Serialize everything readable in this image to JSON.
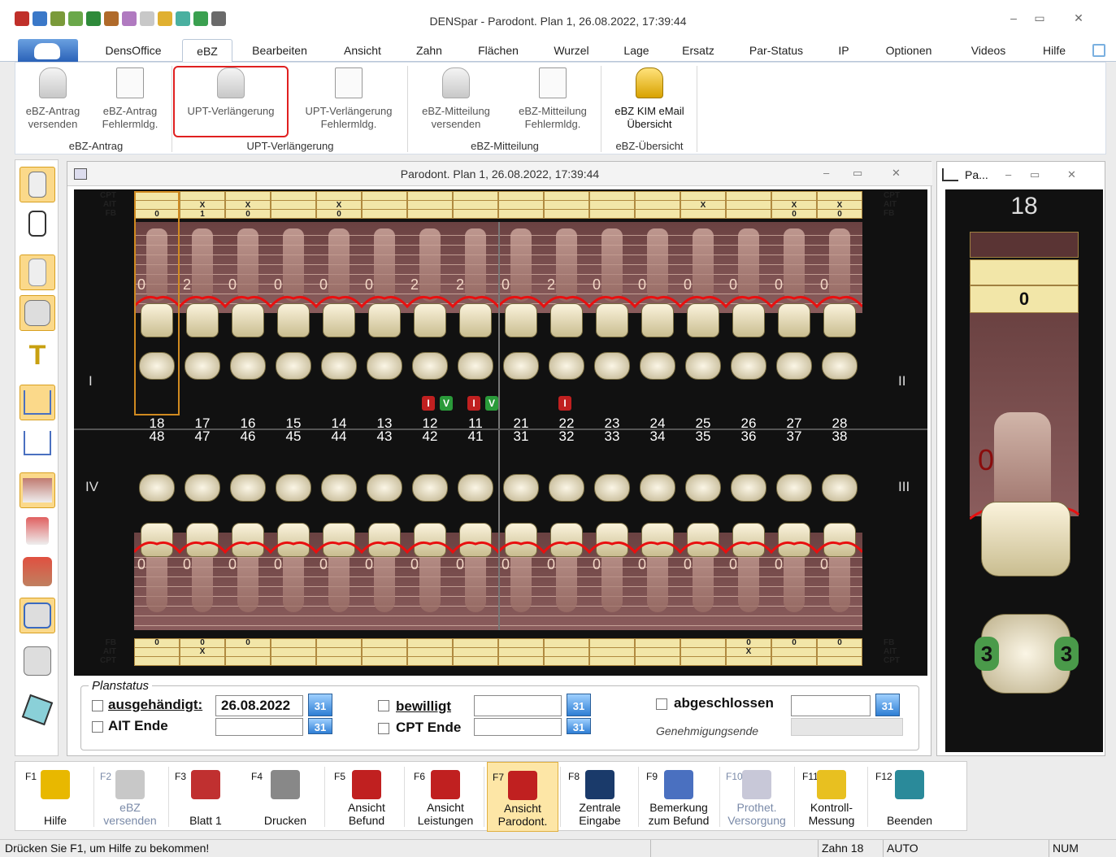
{
  "window": {
    "title": "DENSpar -  Parodont. Plan 1, 26.08.2022, 17:39:44",
    "min": "–",
    "max": "▭",
    "close": "✕"
  },
  "ribbon_tabs": [
    "DensOffice",
    "eBZ",
    "Bearbeiten",
    "Ansicht",
    "Zahn",
    "Flächen",
    "Wurzel",
    "Lage",
    "Ersatz",
    "Par-Status",
    "IP",
    "Optionen",
    "Videos",
    "Hilfe"
  ],
  "ribbon_buttons": [
    {
      "l1": "eBZ-Antrag",
      "l2": "versenden"
    },
    {
      "l1": "eBZ-Antrag",
      "l2": "Fehlermldg."
    },
    {
      "l1": "UPT-Verlängerung",
      "l2": ""
    },
    {
      "l1": "UPT-Verlängerung",
      "l2": "Fehlermldg."
    },
    {
      "l1": "eBZ-Mitteilung",
      "l2": "versenden"
    },
    {
      "l1": "eBZ-Mitteilung",
      "l2": "Fehlermldg."
    },
    {
      "l1": "eBZ KIM eMail",
      "l2": "Übersicht"
    }
  ],
  "ribbon_groups": [
    "eBZ-Antrag",
    "UPT-Verlängerung",
    "eBZ-Mitteilung",
    "eBZ-Übersicht"
  ],
  "doc": {
    "title": "Parodont. Plan 1, 26.08.2022, 17:39:44"
  },
  "chart": {
    "row_labels_top": [
      "CPT",
      "AIT",
      "FB"
    ],
    "row_labels_bottom": [
      "FB",
      "AIT",
      "CPT"
    ],
    "upper_teeth": [
      "18",
      "17",
      "16",
      "15",
      "14",
      "13",
      "12",
      "11",
      "21",
      "22",
      "23",
      "24",
      "25",
      "26",
      "27",
      "28"
    ],
    "lower_teeth": [
      "48",
      "47",
      "46",
      "45",
      "44",
      "43",
      "42",
      "41",
      "31",
      "32",
      "33",
      "34",
      "35",
      "36",
      "37",
      "38"
    ],
    "upper_ait": [
      "",
      "X",
      "X",
      "",
      "X",
      "",
      "",
      "",
      "",
      "",
      "",
      "",
      "X",
      "",
      "X",
      "X"
    ],
    "upper_fb": [
      "0",
      "1",
      "0",
      "",
      "0",
      "",
      "",
      "",
      "",
      "",
      "",
      "",
      "",
      "",
      "0",
      "0"
    ],
    "lower_fb": [
      "0",
      "0",
      "0",
      "",
      "",
      "",
      "",
      "",
      "",
      "",
      "",
      "",
      "",
      "0",
      "0",
      "0"
    ],
    "lower_ait": [
      "",
      "X",
      "",
      "",
      "",
      "",
      "",
      "",
      "",
      "",
      "",
      "",
      "",
      "X",
      "",
      ""
    ],
    "upper_pz": [
      "0",
      "2",
      "0",
      "0",
      "0",
      "0",
      "2",
      "2",
      "0",
      "2",
      "0",
      "0",
      "0",
      "0",
      "0",
      "0"
    ],
    "lower_pz": [
      "0",
      "0",
      "0",
      "0",
      "0",
      "0",
      "0",
      "0",
      "0",
      "0",
      "0",
      "0",
      "0",
      "0",
      "0",
      "0"
    ],
    "quadrants": [
      "I",
      "II",
      "IV",
      "III"
    ]
  },
  "planstatus": {
    "legend": "Planstatus",
    "ausgehaendigt_label": "ausgehändigt:",
    "ausgehaendigt_value": "26.08.2022",
    "ait_ende": "AIT Ende",
    "bewilligt": "bewilligt",
    "cpt_ende": "CPT Ende",
    "abgeschlossen": "abgeschlossen",
    "genehmigungsende": "Genehmigungsende",
    "cal": "31"
  },
  "rightpane": {
    "title": "Pa...",
    "tooth": "18",
    "fb": "0",
    "pz": "0",
    "mesial": "3",
    "distal": "3"
  },
  "fkeys": [
    {
      "k": "F1",
      "l1": "Hilfe",
      "l2": ""
    },
    {
      "k": "F2",
      "l1": "eBZ",
      "l2": "versenden"
    },
    {
      "k": "F3",
      "l1": "Blatt 1",
      "l2": ""
    },
    {
      "k": "F4",
      "l1": "Drucken",
      "l2": ""
    },
    {
      "k": "F5",
      "l1": "Ansicht",
      "l2": "Befund"
    },
    {
      "k": "F6",
      "l1": "Ansicht",
      "l2": "Leistungen"
    },
    {
      "k": "F7",
      "l1": "Ansicht",
      "l2": "Parodont."
    },
    {
      "k": "F8",
      "l1": "Zentrale",
      "l2": "Eingabe"
    },
    {
      "k": "F9",
      "l1": "Bemerkung",
      "l2": "zum Befund"
    },
    {
      "k": "F10",
      "l1": "Prothet.",
      "l2": "Versorgung"
    },
    {
      "k": "F11",
      "l1": "Kontroll-",
      "l2": "Messung"
    },
    {
      "k": "F12",
      "l1": "Beenden",
      "l2": ""
    }
  ],
  "status": {
    "help": "Drücken Sie F1, um Hilfe zu bekommen!",
    "zahn": "Zahn 18",
    "auto": "AUTO",
    "num": "NUM"
  },
  "colors": {
    "accent_red": "#e02020",
    "gum_line": "#e81010",
    "highlight": "#fbd98a"
  }
}
